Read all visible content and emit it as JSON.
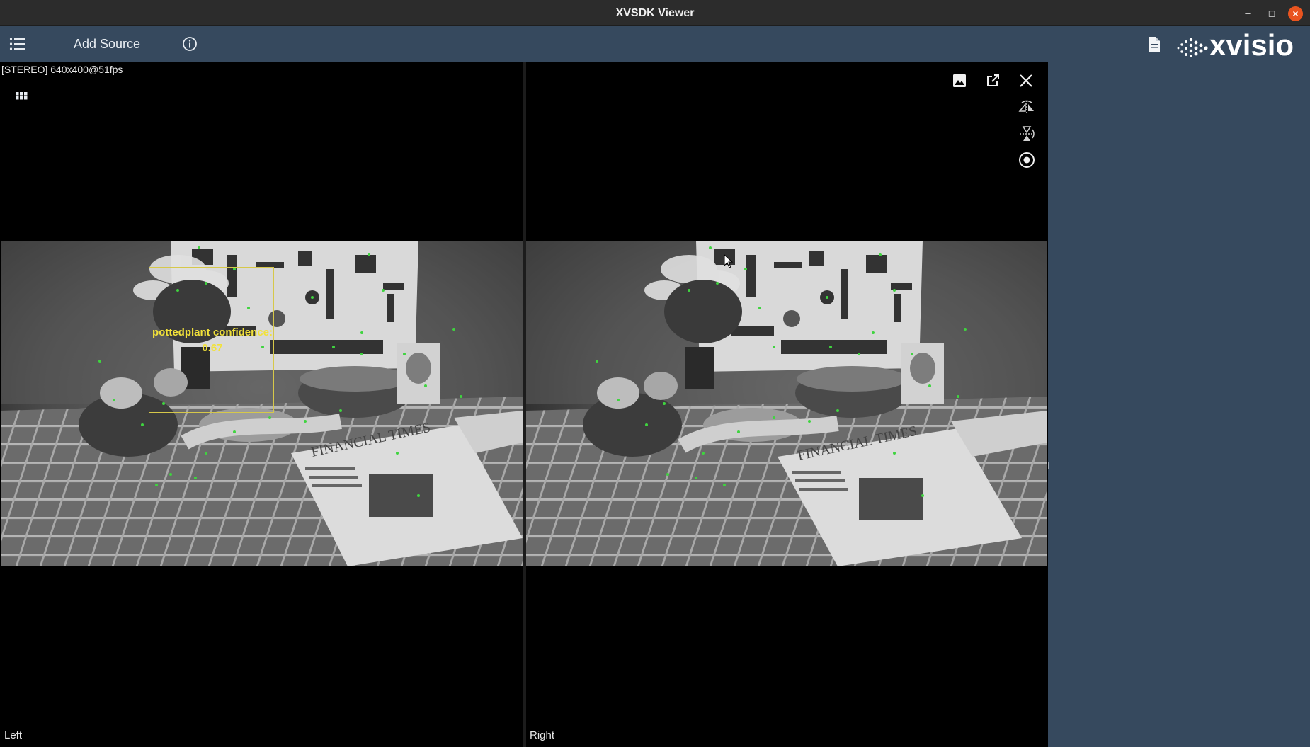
{
  "window": {
    "title": "XVSDK Viewer",
    "minimize": "–",
    "restore": "◻",
    "close": "×"
  },
  "toolbar": {
    "add_source_label": "Add Source",
    "logo_text": "xvisio"
  },
  "stream": {
    "info": "[STEREO]  640x400@51fps"
  },
  "cameras": {
    "left_label": "Left",
    "right_label": "Right"
  },
  "detection": {
    "label_line1": "pottedplant confidence:",
    "label_line2": "0.67",
    "color": "#f2e23a"
  },
  "icons": {
    "menu": "list-icon",
    "info": "info-icon",
    "document": "document-icon",
    "grid": "grid-icon",
    "image": "image-icon",
    "external": "open-external-icon",
    "close": "close-icon",
    "flip_vertical": "flip-vertical-icon",
    "flip_horizontal": "flip-horizontal-icon",
    "record": "record-icon"
  },
  "colors": {
    "toolbar": "#36495e",
    "titlebar": "#2c2c2c",
    "close_button": "#e9541f",
    "feature_points": "#3fd43f"
  }
}
